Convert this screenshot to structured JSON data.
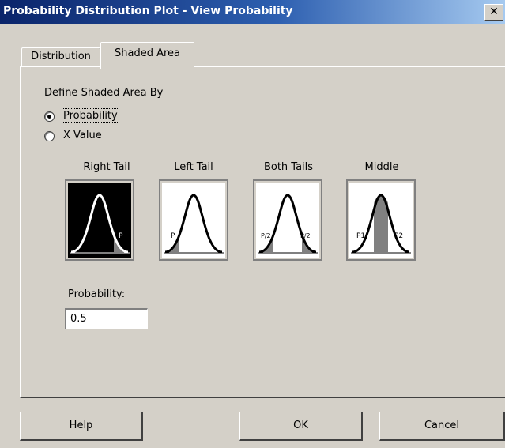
{
  "window": {
    "title": "Probability Distribution Plot - View Probability",
    "close_glyph": "✕"
  },
  "tabs": [
    {
      "label": "Distribution",
      "active": false
    },
    {
      "label": "Shaded Area",
      "active": true
    }
  ],
  "define": {
    "group_label": "Define Shaded Area By",
    "options": [
      {
        "label": "Probability",
        "selected": true
      },
      {
        "label": "X Value",
        "selected": false
      }
    ]
  },
  "area_types": [
    {
      "label": "Right Tail",
      "selected": true,
      "tag": "P"
    },
    {
      "label": "Left Tail",
      "selected": false,
      "tag": "P"
    },
    {
      "label": "Both Tails",
      "selected": false,
      "tag_left": "P/2",
      "tag_right": "P/2"
    },
    {
      "label": "Middle",
      "selected": false,
      "tag_left": "P1",
      "tag_right": "P2"
    }
  ],
  "probability": {
    "label": "Probability:",
    "value": "0.5"
  },
  "buttons": {
    "help": "Help",
    "ok": "OK",
    "cancel": "Cancel"
  },
  "colors": {
    "title_bar": "#0a246a",
    "face": "#d4d0c8",
    "shade": "#808080",
    "selected_tile": "#000000"
  }
}
